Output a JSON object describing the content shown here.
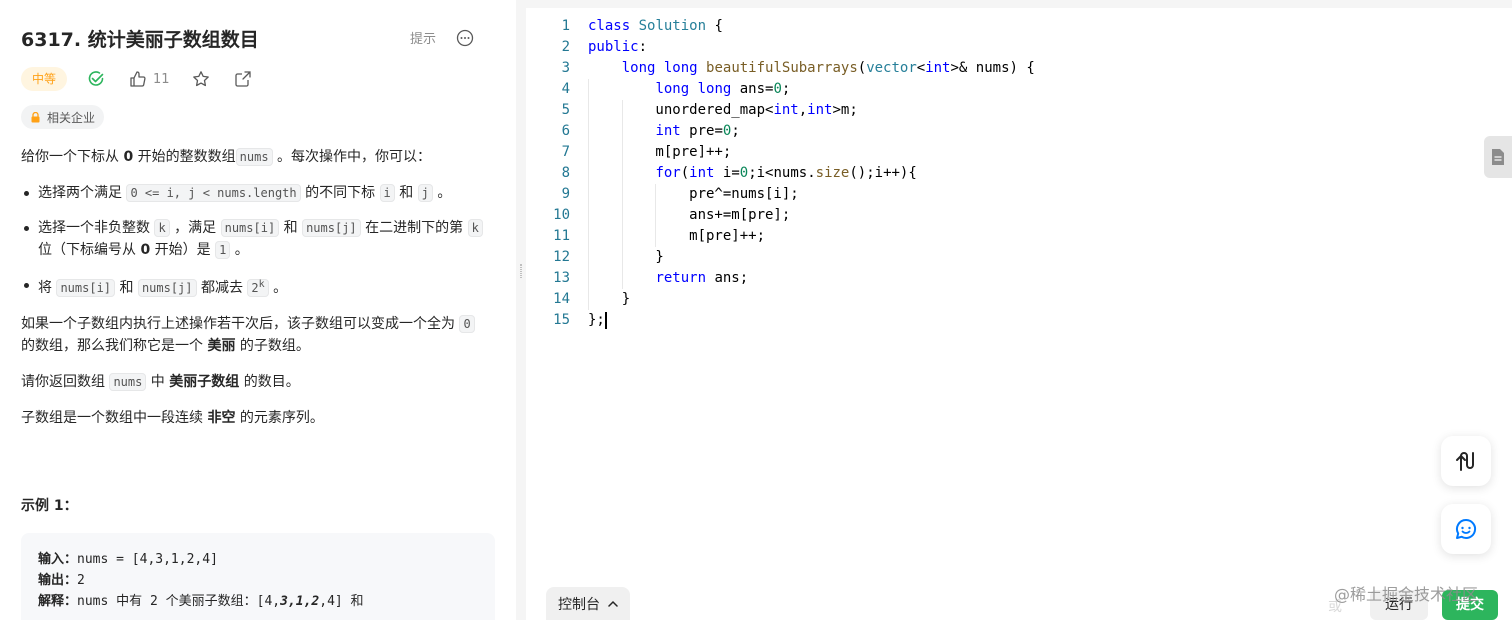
{
  "problem": {
    "title": "6317. 统计美丽子数组数目",
    "hint_label": "提示",
    "difficulty": "中等",
    "like_count": "11",
    "company_label": "相关企业"
  },
  "description": {
    "p1_a": "给你一个下标从 ",
    "p1_b": "0",
    "p1_c": " 开始的整数数组",
    "p1_code": "nums",
    "p1_d": " 。每次操作中，你可以：",
    "b1_a": "选择两个满足 ",
    "b1_code1": "0 <= i, j < nums.length",
    "b1_b": " 的不同下标 ",
    "b1_code2": "i",
    "b1_c": " 和 ",
    "b1_code3": "j",
    "b1_d": " 。",
    "b2_a": "选择一个非负整数 ",
    "b2_code1": "k",
    "b2_b": " ，满足 ",
    "b2_code2": "nums[i]",
    "b2_c": " 和 ",
    "b2_code3": "nums[j]",
    "b2_d": " 在二进制下的第 ",
    "b2_code4": "k",
    "b2_e": " 位（下标编号从 ",
    "b2_bold": "0",
    "b2_f": " 开始）是 ",
    "b2_code5": "1",
    "b2_g": " 。",
    "b3_a": "将 ",
    "b3_code1": "nums[i]",
    "b3_b": " 和 ",
    "b3_code2": "nums[j]",
    "b3_c": " 都减去 ",
    "b3_code3_base": "2",
    "b3_code3_exp": "k",
    "b3_d": " 。",
    "p2_a": "如果一个子数组内执行上述操作若干次后，该子数组可以变成一个全为 ",
    "p2_code": "0",
    "p2_b": " 的数组，那么我们称它是一个 ",
    "p2_bold": "美丽",
    "p2_c": " 的子数组。",
    "p3_a": "请你返回数组 ",
    "p3_code": "nums",
    "p3_b": " 中 ",
    "p3_bold": "美丽子数组",
    "p3_c": " 的数目。",
    "p4_a": "子数组是一个数组中一段连续 ",
    "p4_bold": "非空",
    "p4_b": " 的元素序列。"
  },
  "example": {
    "title": "示例 1：",
    "input_label": "输入：",
    "input_value": "nums = [4,3,1,2,4]",
    "output_label": "输出：",
    "output_value": "2",
    "explain_label": "解释：",
    "explain_a": "nums 中有 2 个美丽子数组：[4,",
    "explain_bold": "3,1,2",
    "explain_b": ",4] 和"
  },
  "editor": {
    "line_numbers": [
      "1",
      "2",
      "3",
      "4",
      "5",
      "6",
      "7",
      "8",
      "9",
      "10",
      "11",
      "12",
      "13",
      "14",
      "15"
    ]
  },
  "bottom": {
    "console_label": "控制台",
    "run_label": "运行",
    "submit_label": "提交",
    "watermark": "@稀土掘金技术社区",
    "faint_label": "或"
  },
  "colors": {
    "difficulty_medium": "#ffa116",
    "submit_green": "#2db55d",
    "accepted_green": "#2db55d",
    "accent_blue": "#007aff"
  }
}
